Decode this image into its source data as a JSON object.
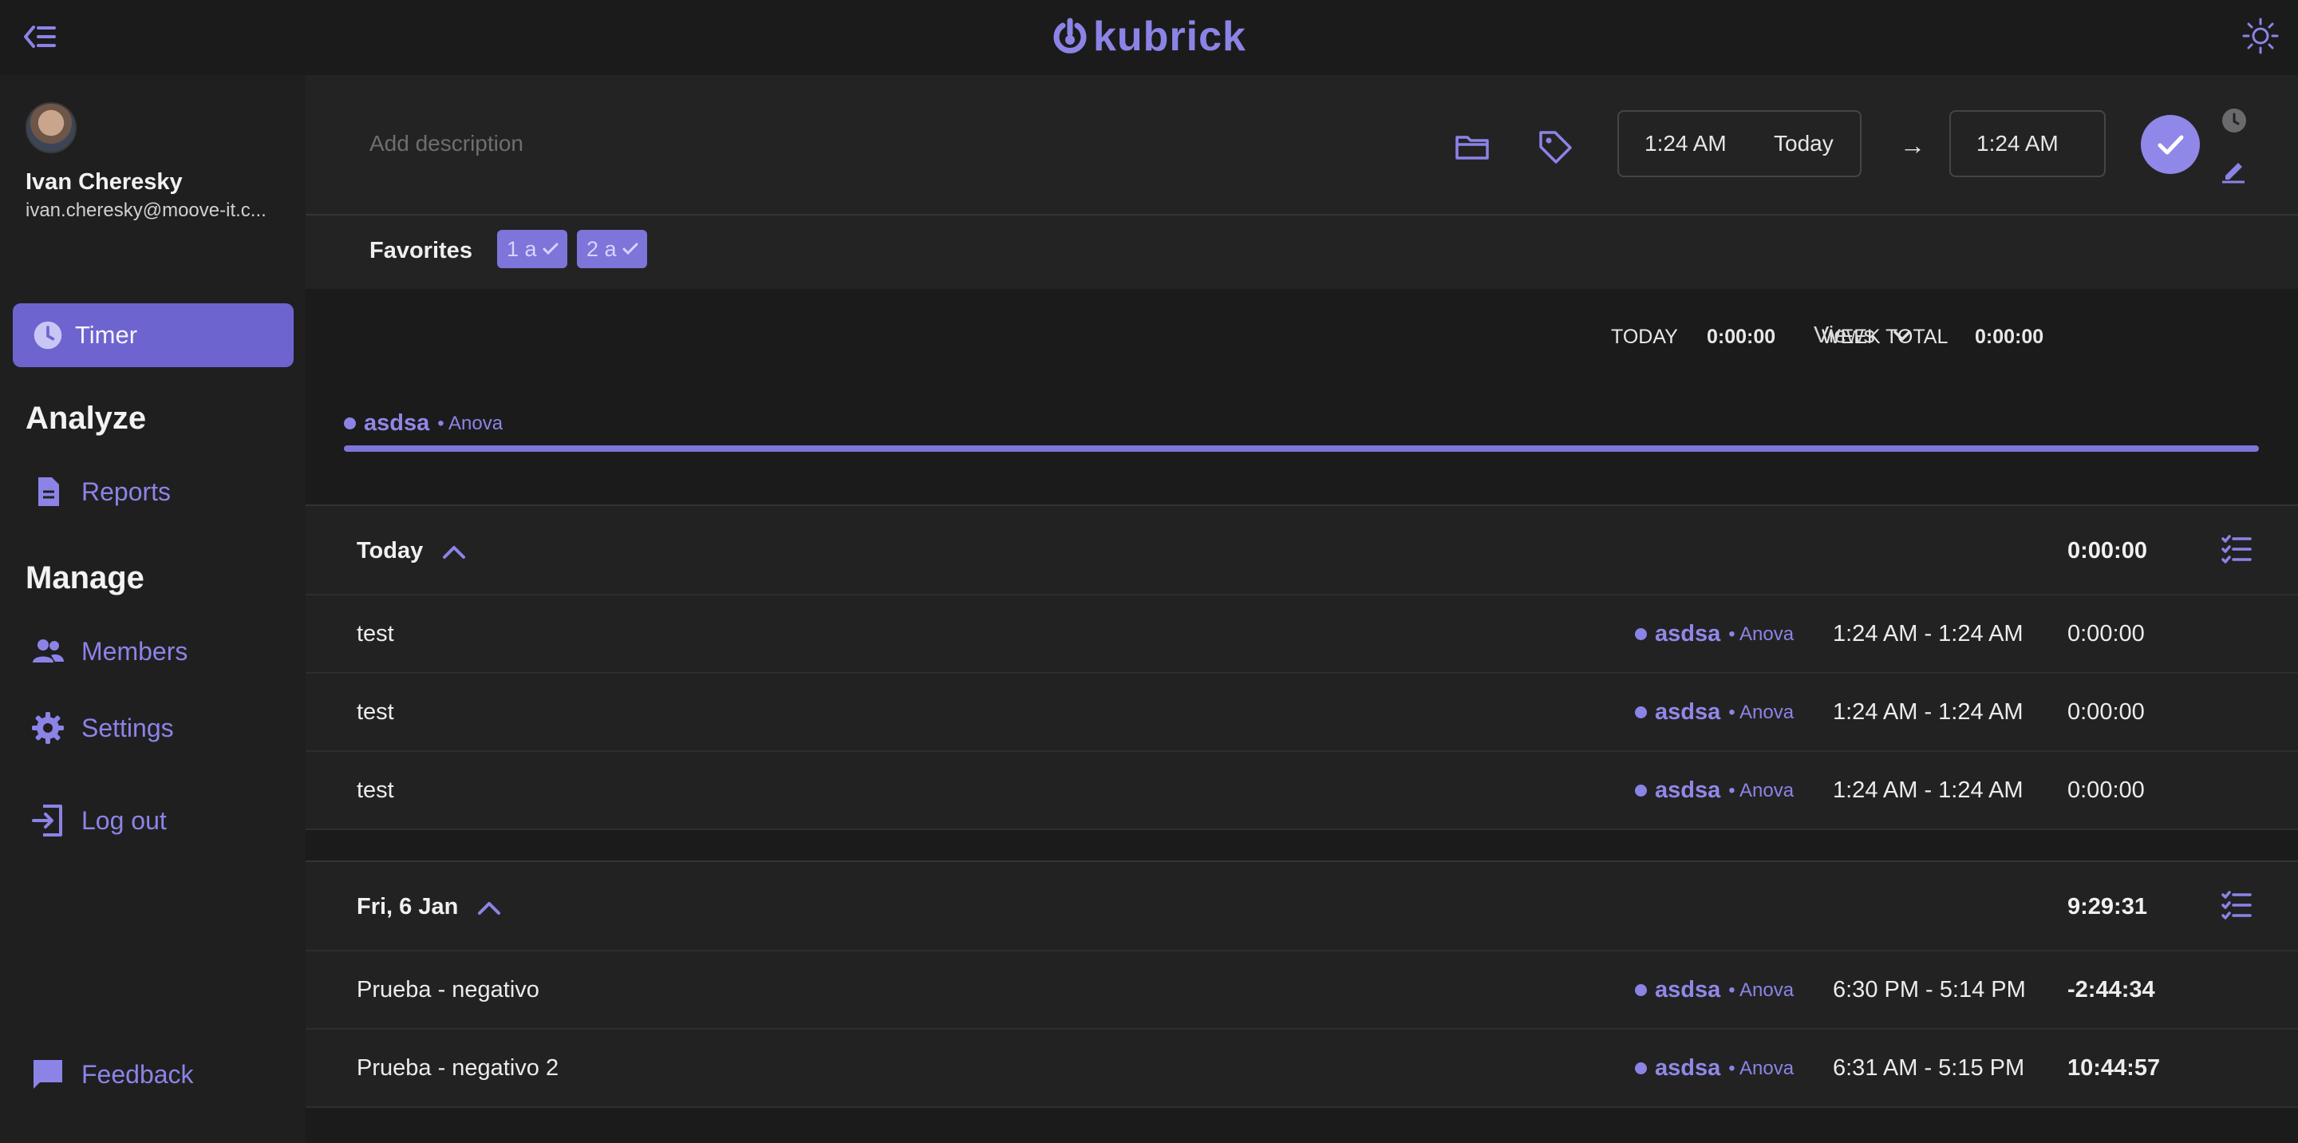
{
  "app": {
    "logo_text": "kubrick"
  },
  "user": {
    "name": "Ivan Cheresky",
    "email": "ivan.cheresky@moove-it.c..."
  },
  "nav": {
    "timer": "Timer",
    "analyze_title": "Analyze",
    "reports": "Reports",
    "manage_title": "Manage",
    "members": "Members",
    "settings": "Settings",
    "logout": "Log out",
    "feedback": "Feedback"
  },
  "entry": {
    "description_placeholder": "Add description",
    "start_time": "1:24 AM",
    "start_day": "Today",
    "end_time": "1:24 AM"
  },
  "favorites": {
    "label": "Favorites",
    "chips": [
      "1 a",
      "2 a"
    ]
  },
  "summary": {
    "today_label": "TODAY",
    "today_value": "0:00:00",
    "week_label": "WEEK TOTAL",
    "week_value": "0:00:00",
    "views_label": "Views"
  },
  "project_summary": {
    "name": "asdsa",
    "client": "Anova",
    "progress_fraction": 1.0
  },
  "groups": [
    {
      "title": "Today",
      "total": "0:00:00",
      "entries": [
        {
          "description": "test",
          "project": "asdsa",
          "client": "Anova",
          "range": "1:24 AM - 1:24 AM",
          "duration": "0:00:00"
        },
        {
          "description": "test",
          "project": "asdsa",
          "client": "Anova",
          "range": "1:24 AM - 1:24 AM",
          "duration": "0:00:00"
        },
        {
          "description": "test",
          "project": "asdsa",
          "client": "Anova",
          "range": "1:24 AM - 1:24 AM",
          "duration": "0:00:00"
        }
      ]
    },
    {
      "title": "Fri, 6 Jan",
      "total": "9:29:31",
      "entries": [
        {
          "description": "Prueba - negativo",
          "project": "asdsa",
          "client": "Anova",
          "range": "6:30 PM - 5:14 PM",
          "duration": "-2:44:34"
        },
        {
          "description": "Prueba - negativo 2",
          "project": "asdsa",
          "client": "Anova",
          "range": "6:31 AM - 5:15 PM",
          "duration": "10:44:57"
        }
      ]
    }
  ],
  "colors": {
    "accent": "#8b84e6",
    "active_nav": "#6d64cf",
    "background": "#1b1b1c"
  }
}
